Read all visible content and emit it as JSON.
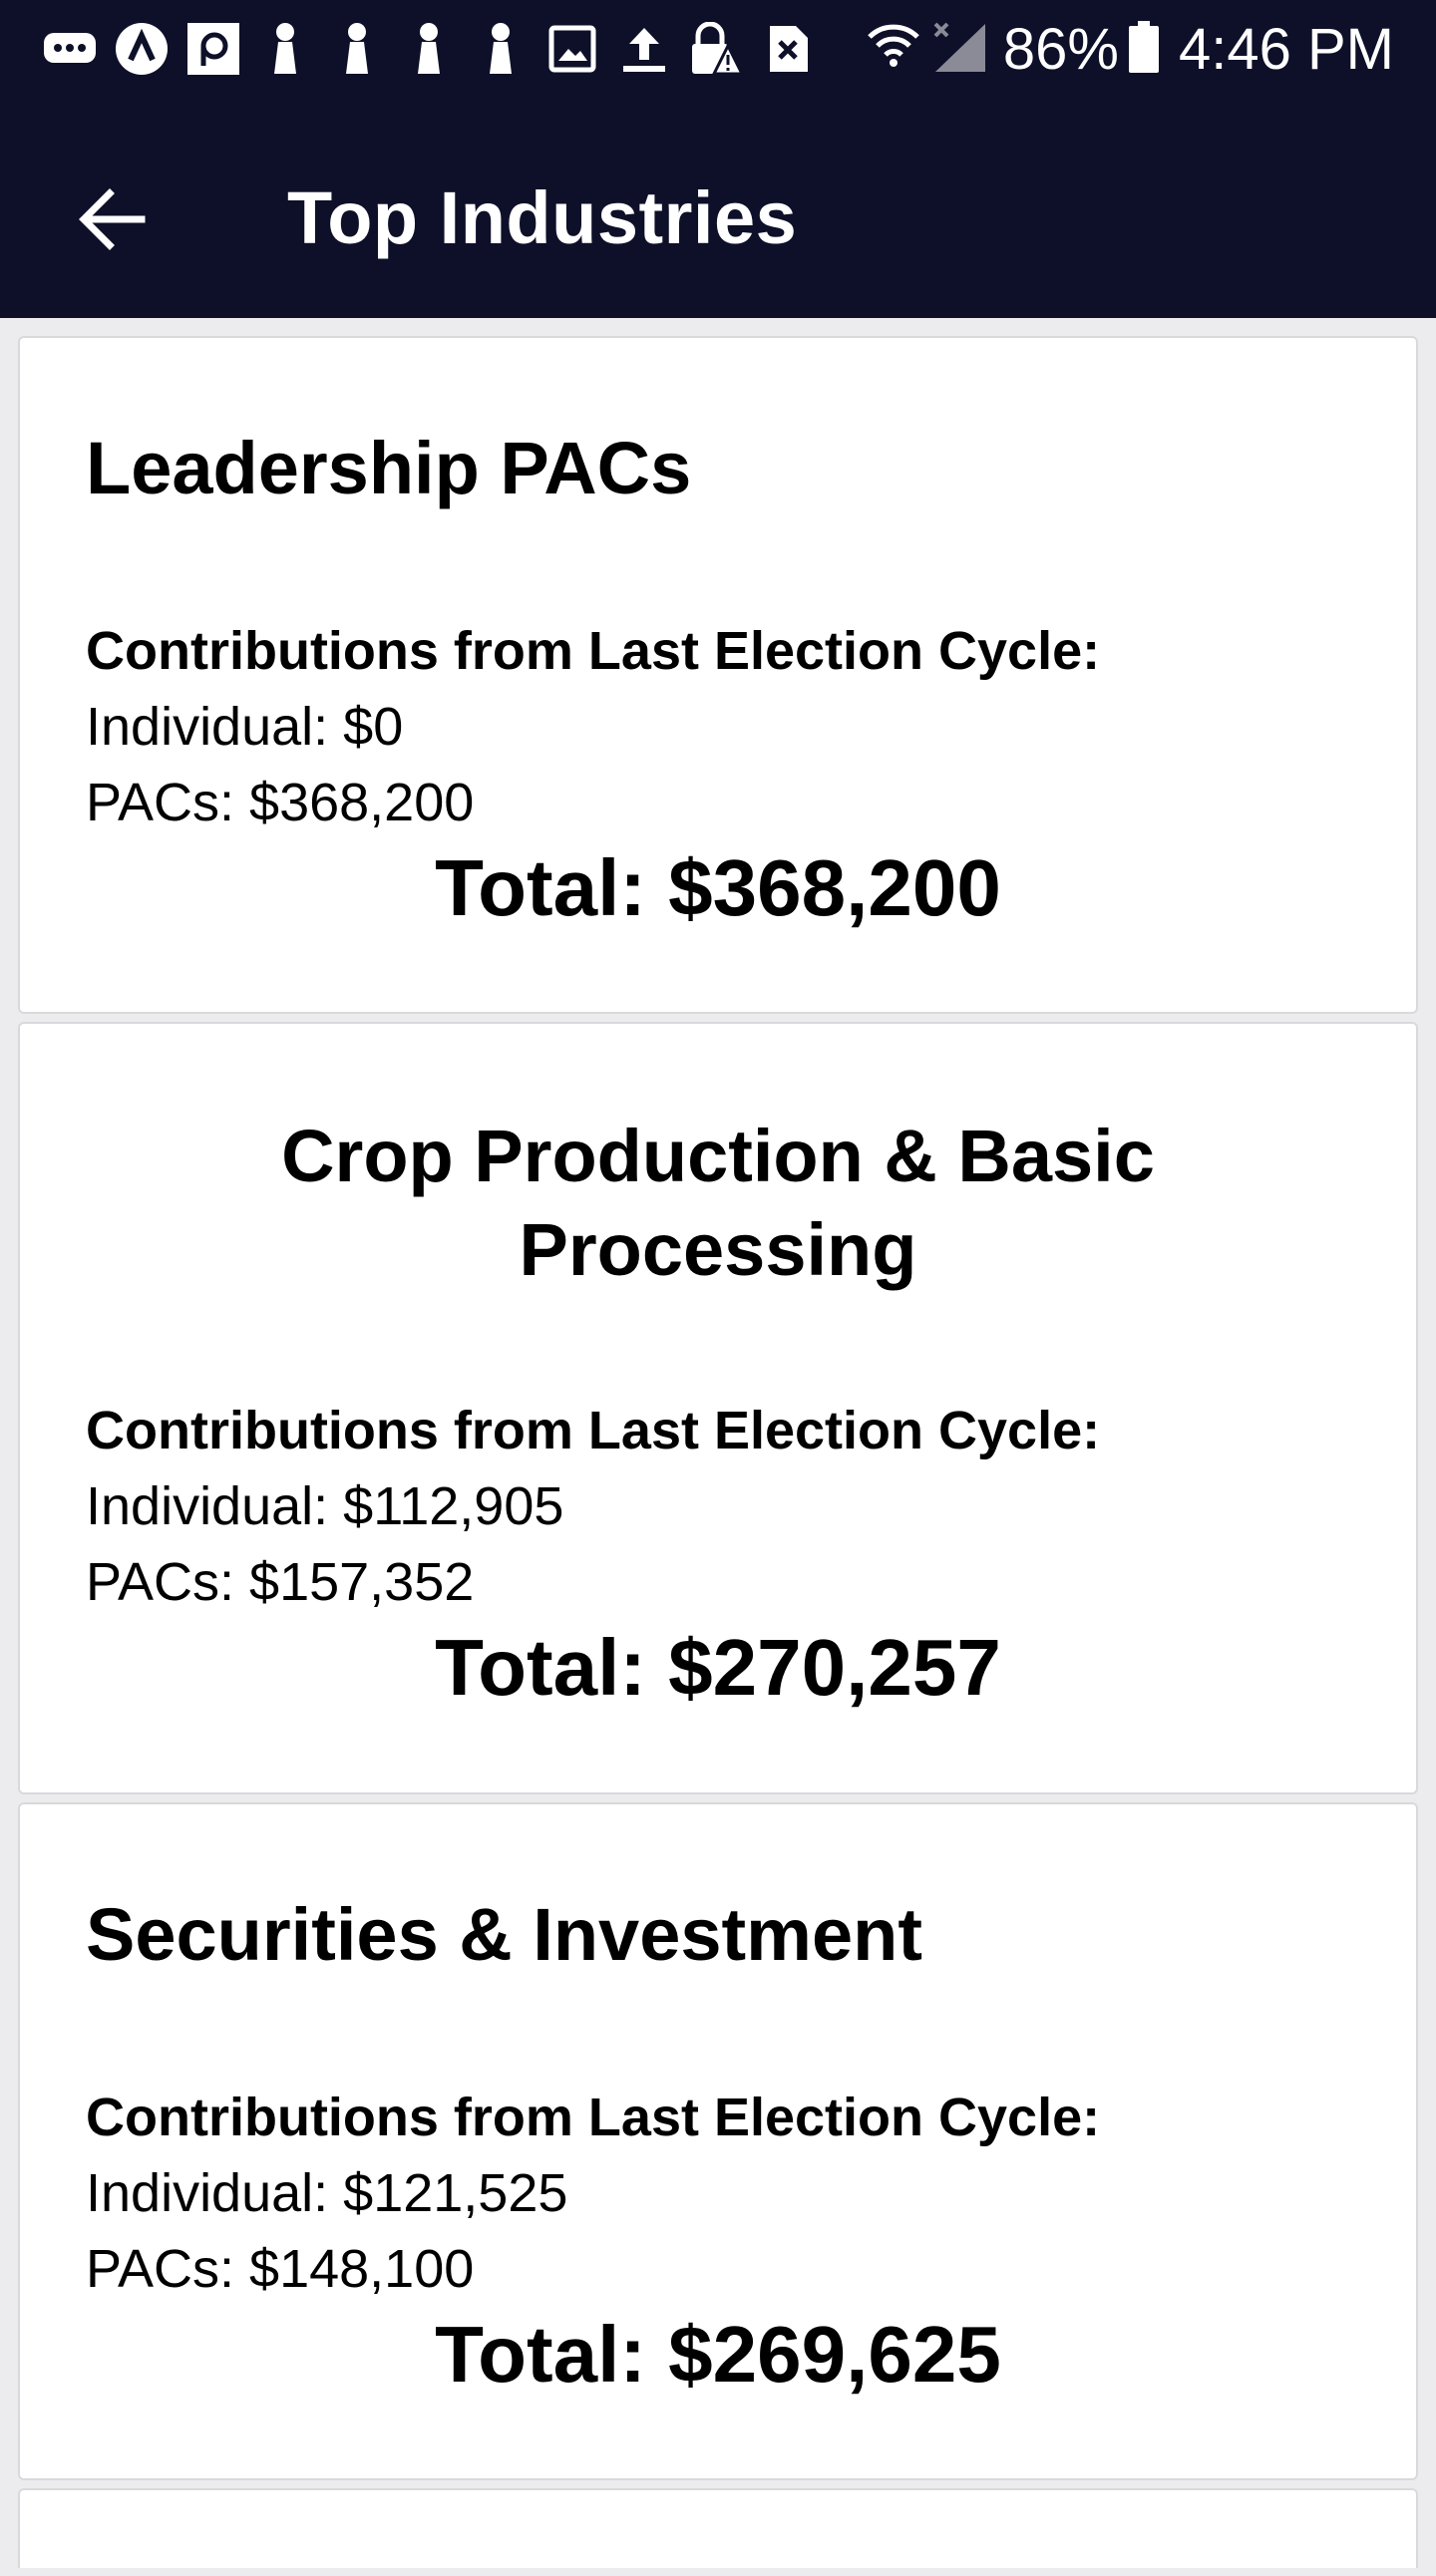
{
  "status_bar": {
    "notification_icons": [
      "message-icon",
      "navigation-app-icon",
      "parking-app-icon",
      "person-icon",
      "person-icon",
      "person-icon",
      "person-icon",
      "image-icon",
      "upload-icon",
      "vpn-lock-warning-icon",
      "close-box-icon"
    ],
    "battery_percent": "86%",
    "time": "4:46 PM"
  },
  "app_bar": {
    "title": "Top Industries"
  },
  "industries": [
    {
      "name": "Leadership PACs",
      "contributions_label": "Contributions from Last Election Cycle:",
      "individual": "Individual: $0",
      "pacs": "PACs: $368,200",
      "total": "Total: $368,200"
    },
    {
      "name": "Crop Production & Basic Processing",
      "name_line1": "Crop Production & Basic",
      "name_line2": "Processing",
      "contributions_label": "Contributions from Last Election Cycle:",
      "individual": "Individual: $112,905",
      "pacs": "PACs: $157,352",
      "total": "Total: $270,257"
    },
    {
      "name": "Securities & Investment",
      "contributions_label": "Contributions from Last Election Cycle:",
      "individual": "Individual: $121,525",
      "pacs": "PACs: $148,100",
      "total": "Total: $269,625"
    }
  ],
  "colors": {
    "app_bar_background": "#0e1029",
    "page_background": "#ececee",
    "card_background": "#ffffff"
  }
}
